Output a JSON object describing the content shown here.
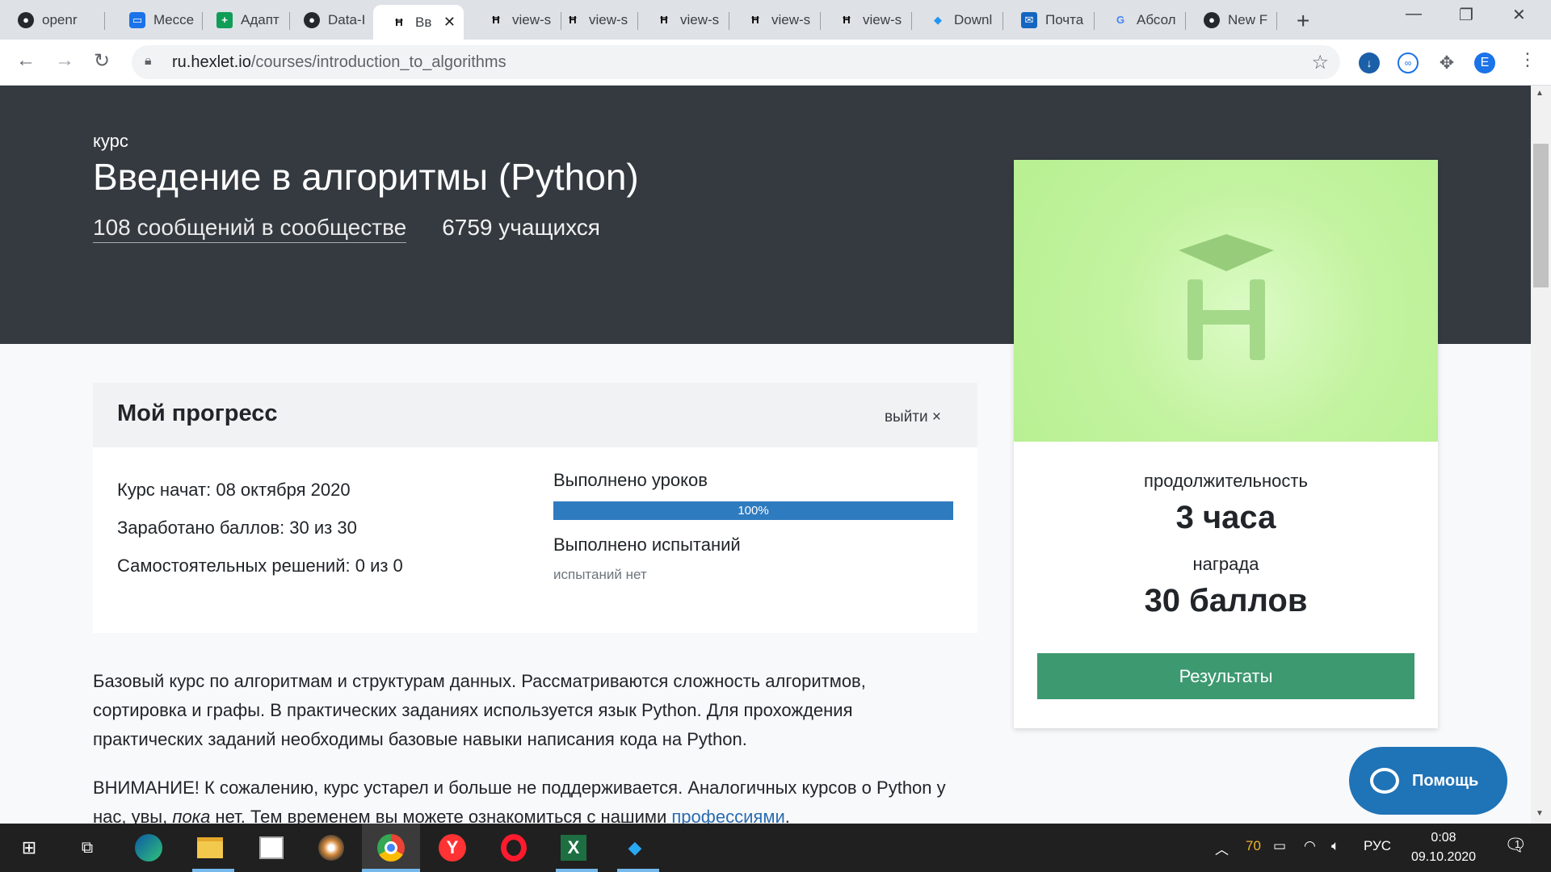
{
  "browser": {
    "tabs": [
      {
        "title": "openr",
        "icon": "github-icon"
      },
      {
        "title": "Mecce",
        "icon": "messenger-icon"
      },
      {
        "title": "Адапт",
        "icon": "sheets-icon"
      },
      {
        "title": "Data-I",
        "icon": "github-icon"
      },
      {
        "title": "Вв",
        "icon": "hexlet-icon",
        "active": true
      },
      {
        "title": "view-s",
        "icon": "hexlet-icon"
      },
      {
        "title": "view-s",
        "icon": "hexlet-icon"
      },
      {
        "title": "view-s",
        "icon": "hexlet-icon"
      },
      {
        "title": "view-s",
        "icon": "hexlet-icon"
      },
      {
        "title": "view-s",
        "icon": "hexlet-icon"
      },
      {
        "title": "Downl",
        "icon": "diamond-icon"
      },
      {
        "title": "Почта",
        "icon": "mail-icon"
      },
      {
        "title": "Абсол",
        "icon": "google-icon"
      },
      {
        "title": "New F",
        "icon": "github-icon"
      }
    ],
    "url_domain": "ru.hexlet.io",
    "url_path": "/courses/introduction_to_algorithms",
    "profile_initial": "E"
  },
  "hero": {
    "kicker": "курс",
    "title": "Введение в алгоритмы (Python)",
    "community_link": "108 сообщений в сообществе",
    "students": "6759 учащихся"
  },
  "progress": {
    "heading": "Мой прогресс",
    "logout": "выйти ×",
    "started": "Курс начат: 08 октября 2020",
    "points": "Заработано баллов: 30 из 30",
    "solutions": "Самостоятельных решений: 0 из 0",
    "lessons_label": "Выполнено уроков",
    "lessons_percent_text": "100%",
    "lessons_fraction": 1.0,
    "tests_label": "Выполнено испытаний",
    "tests_none": "испытаний нет"
  },
  "description": {
    "p1": "Базовый курс по алгоритмам и структурам данных. Рассматриваются сложность алгоритмов, сортировка и графы. В практических заданиях используется язык Python. Для прохождения практических заданий необходимы базовые навыки написания кода на Python.",
    "p2_start": "ВНИМАНИЕ! К сожалению, курс устарел и больше не поддерживается. Аналогичных курсов о Python у нас, увы, ",
    "p2_em": "пока",
    "p2_mid": " нет. Тем временем вы можете ознакомиться с нашими ",
    "p2_link": "профессиями",
    "p2_end": "."
  },
  "side_card": {
    "duration_label": "продолжительность",
    "duration_value": "3 часа",
    "reward_label": "награда",
    "reward_value": "30 баллов",
    "results_button": "Результаты"
  },
  "help_button": "Помощь",
  "taskbar": {
    "temperature": "70",
    "language": "РУС",
    "time": "0:08",
    "date": "09.10.2020",
    "notifications": "1"
  }
}
